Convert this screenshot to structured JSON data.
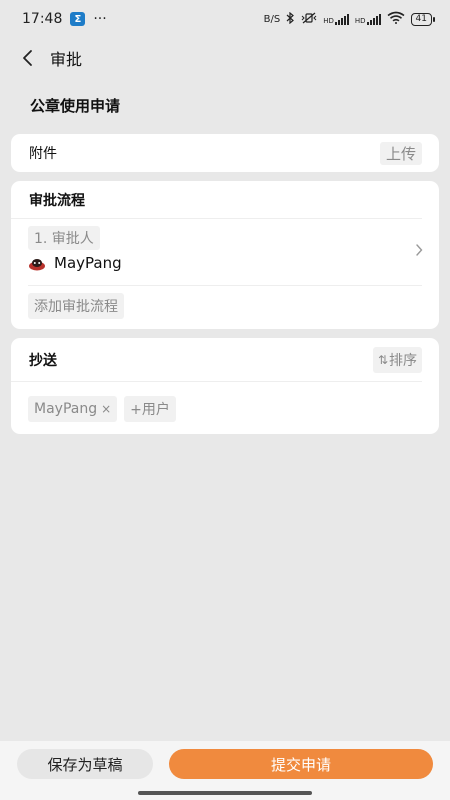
{
  "status_bar": {
    "time": "17:48",
    "app_badge": "Σ",
    "more": "···",
    "data_speed": "B/S",
    "network_1": "HD",
    "network_2": "HD",
    "battery": "41"
  },
  "nav": {
    "title": "审批",
    "back_icon": "chevron-left-icon"
  },
  "form": {
    "title": "公章使用申请",
    "attachment": {
      "label": "附件",
      "upload_label": "上传"
    },
    "approval_flow": {
      "title": "审批流程",
      "step_label": "1. 审批人",
      "approver_name": "MayPang",
      "add_label": "添加审批流程"
    },
    "cc": {
      "title": "抄送",
      "sort_icon": "⇅",
      "sort_label": "排序",
      "users": [
        {
          "name": "MayPang",
          "remove": "×"
        }
      ],
      "add_user_label": "+用户"
    }
  },
  "bottom": {
    "draft_label": "保存为草稿",
    "submit_label": "提交申请",
    "colors": {
      "accent": "#f08a3e"
    }
  }
}
